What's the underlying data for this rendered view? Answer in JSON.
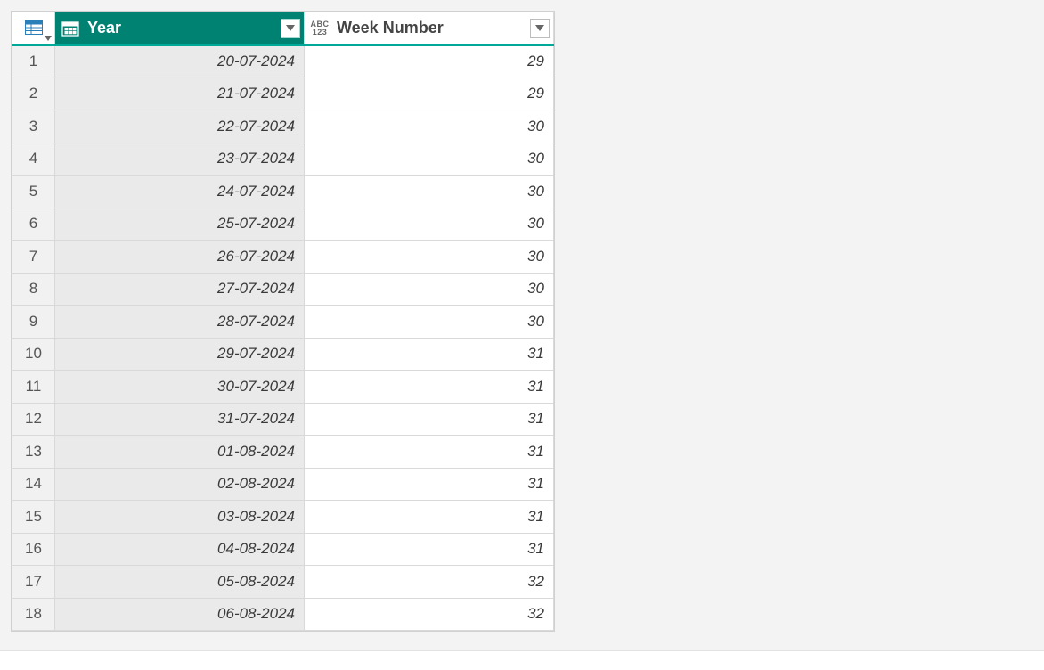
{
  "columns": [
    {
      "name": "Year",
      "type": "date"
    },
    {
      "name": "Week Number",
      "type": "any"
    }
  ],
  "rows": [
    {
      "n": "1",
      "year": "20-07-2024",
      "week": "29"
    },
    {
      "n": "2",
      "year": "21-07-2024",
      "week": "29"
    },
    {
      "n": "3",
      "year": "22-07-2024",
      "week": "30"
    },
    {
      "n": "4",
      "year": "23-07-2024",
      "week": "30"
    },
    {
      "n": "5",
      "year": "24-07-2024",
      "week": "30"
    },
    {
      "n": "6",
      "year": "25-07-2024",
      "week": "30"
    },
    {
      "n": "7",
      "year": "26-07-2024",
      "week": "30"
    },
    {
      "n": "8",
      "year": "27-07-2024",
      "week": "30"
    },
    {
      "n": "9",
      "year": "28-07-2024",
      "week": "30"
    },
    {
      "n": "10",
      "year": "29-07-2024",
      "week": "31"
    },
    {
      "n": "11",
      "year": "30-07-2024",
      "week": "31"
    },
    {
      "n": "12",
      "year": "31-07-2024",
      "week": "31"
    },
    {
      "n": "13",
      "year": "01-08-2024",
      "week": "31"
    },
    {
      "n": "14",
      "year": "02-08-2024",
      "week": "31"
    },
    {
      "n": "15",
      "year": "03-08-2024",
      "week": "31"
    },
    {
      "n": "16",
      "year": "04-08-2024",
      "week": "31"
    },
    {
      "n": "17",
      "year": "05-08-2024",
      "week": "32"
    },
    {
      "n": "18",
      "year": "06-08-2024",
      "week": "32"
    }
  ]
}
